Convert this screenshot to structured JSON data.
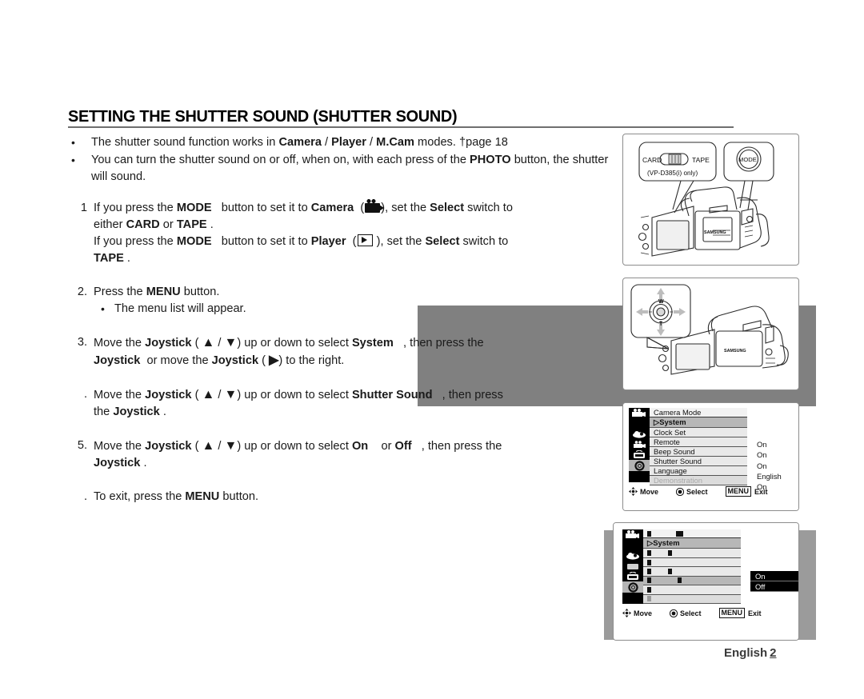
{
  "heading": {
    "title": "SETTING THE SHUTTER SOUND (SHUTTER SOUND)"
  },
  "intro": {
    "bullet_marker": "•",
    "items": [
      {
        "parts": [
          {
            "text": "The shutter sound function works in ",
            "bold": false
          },
          {
            "text": "Camera",
            "bold": true
          },
          {
            "text": " / ",
            "bold": false
          },
          {
            "text": "Player",
            "bold": true
          },
          {
            "text": " / ",
            "bold": false
          },
          {
            "text": "M.Cam",
            "bold": true
          },
          {
            "text": " modes.  †page 18",
            "bold": false
          }
        ]
      },
      {
        "parts": [
          {
            "text": "You can turn the shutter sound on or off, when on, with each press of the ",
            "bold": false
          },
          {
            "text": "PHOTO",
            "bold": true
          },
          {
            "text": " button, the shutter will sound.",
            "bold": false
          }
        ]
      }
    ]
  },
  "steps": [
    {
      "number": "1",
      "lines": [
        "If you press the MODE button to set it to Camera ( camcorder-icon ), set the Select switch to",
        "either CARD or TAPE .",
        "If you press the MODE button to set it to Player ( play-icon ), set the Select switch to",
        "TAPE ."
      ]
    },
    {
      "number": "2.",
      "lines": [
        "Press the MENU button."
      ],
      "sub_bullets": [
        "The menu list will appear."
      ]
    },
    {
      "number": "3.",
      "lines": [
        "Move the Joystick ( ▲ / ▼ ) up or down to select System , then press the",
        "Joystick or move the Joystick ( ▶ ) to the right."
      ]
    },
    {
      "number": ".",
      "lines": [
        "Move the Joystick ( ▲ / ▼ ) up or down to select Shutter Sound , then press",
        "the Joystick ."
      ]
    },
    {
      "number": "5.",
      "lines": [
        "Move the Joystick ( ▲ / ▼ ) up or down to select On or Off , then press the",
        "Joystick ."
      ]
    },
    {
      "number": ".",
      "lines": [
        "To exit, press the MENU button."
      ]
    }
  ],
  "step_words": {
    "mode": "MODE",
    "menu": "MENU",
    "camera": "Camera",
    "player": "Player",
    "select": "Select",
    "card": "CARD",
    "tape": "TAPE",
    "joystick": "Joystick",
    "system": "System",
    "shutter_sound": "Shutter Sound",
    "on": "On",
    "off": "Off",
    "up_glyph": "▲",
    "down_glyph": "▼",
    "right_glyph": "▶"
  },
  "figures": {
    "camera_mode": {
      "name": "camcorder-card-tape-mode",
      "card_label": "CARD",
      "tape_label": "TAPE",
      "model_note": "(VP-D385(i) only)",
      "mode_button_label": "MODE",
      "brand": "SAMSUNG"
    },
    "joystick": {
      "name": "camcorder-joystick",
      "wide_label": "W",
      "tele_label": "T",
      "brand": "SAMSUNG"
    },
    "menu_system": {
      "title": "Camera Mode",
      "selected_group": "▷System",
      "rows": [
        {
          "label": "Clock Set",
          "value": ""
        },
        {
          "label": "Remote",
          "value": "On"
        },
        {
          "label": "Beep Sound",
          "value": "On"
        },
        {
          "label": "Shutter Sound",
          "value": "On"
        },
        {
          "label": "Language",
          "value": "English"
        },
        {
          "label": "Demonstration",
          "value": "On",
          "dim": true
        }
      ],
      "footer": {
        "move": "Move",
        "select": "Select",
        "menu_key": "MENU",
        "exit": "Exit"
      }
    },
    "menu_onoff": {
      "title": "",
      "selected_group": "▷System",
      "rows": [
        {
          "label": "",
          "value": ""
        },
        {
          "label": "",
          "value": ""
        },
        {
          "label": "",
          "value": ""
        },
        {
          "label": "",
          "value": "",
          "highlight": true
        },
        {
          "label": "",
          "value": ""
        },
        {
          "label": "",
          "value": "",
          "dim": true
        }
      ],
      "submenu": [
        "On",
        "Off"
      ],
      "footer": {
        "move": "Move",
        "select": "Select",
        "menu_key": "MENU",
        "exit": "Exit"
      }
    }
  },
  "footer": {
    "language": "English",
    "page_number": "2"
  },
  "colors": {
    "band_mid": "#808080",
    "band_bottom": "#9b9b9b",
    "rule": "#6f6f6f",
    "text": "#1a1a1a",
    "footer_text": "#3a3a3a"
  }
}
